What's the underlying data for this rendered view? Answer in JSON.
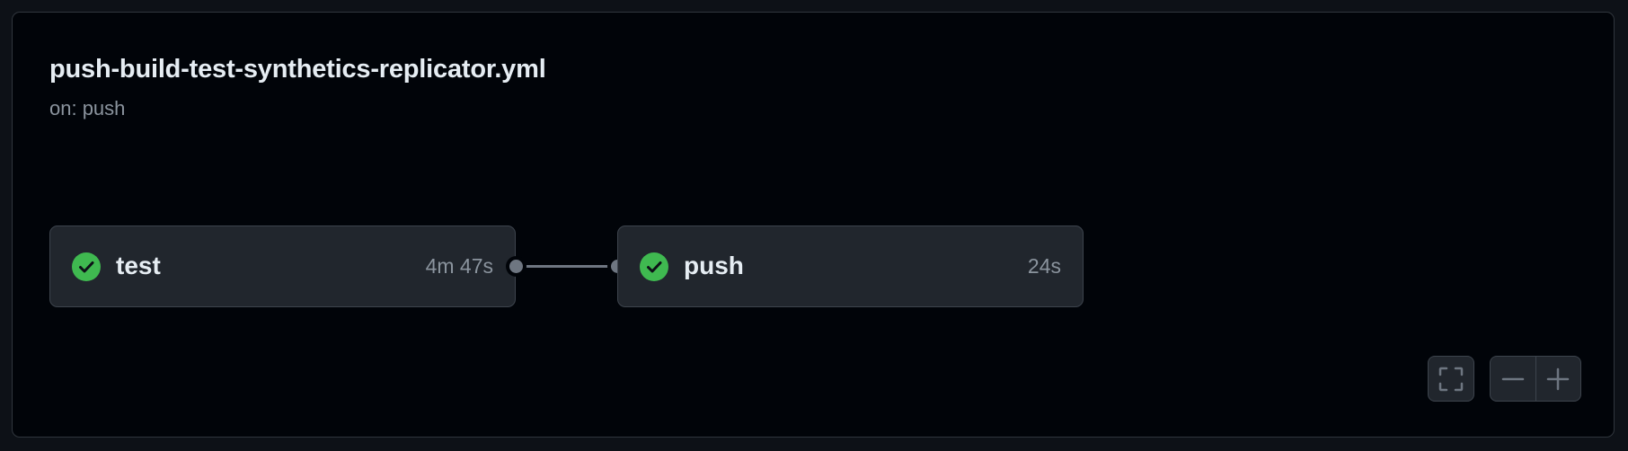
{
  "workflow": {
    "title": "push-build-test-synthetics-replicator.yml",
    "trigger": "on: push"
  },
  "jobs": [
    {
      "name": "test",
      "duration": "4m 47s",
      "status": "success",
      "icon": "check-circle-icon"
    },
    {
      "name": "push",
      "duration": "24s",
      "status": "success",
      "icon": "check-circle-icon"
    }
  ],
  "controls": {
    "fullscreen_icon": "fullscreen-icon",
    "zoom_out_icon": "zoom-out-icon",
    "zoom_in_icon": "zoom-in-icon"
  },
  "colors": {
    "background": "#010409",
    "job_bg": "#21262d",
    "success": "#3fb950",
    "text_primary": "#e6edf3",
    "text_muted": "#8b949e"
  }
}
